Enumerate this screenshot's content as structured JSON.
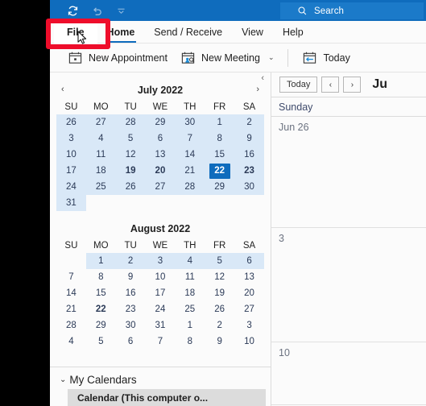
{
  "titlebar": {
    "quick_access": [
      {
        "name": "sync-icon",
        "label": "Send/Receive All Folders"
      },
      {
        "name": "undo-icon",
        "label": "Undo"
      },
      {
        "name": "customize-quick-access-chevron-icon",
        "label": "Customize Quick Access Toolbar"
      }
    ],
    "search": {
      "icon": "search-icon",
      "placeholder": "Search",
      "value": "Search"
    }
  },
  "ribbon": {
    "tabs": [
      {
        "label": "File",
        "active": false,
        "file": true
      },
      {
        "label": "Home",
        "active": true,
        "file": false
      },
      {
        "label": "Send / Receive",
        "active": false,
        "file": false
      },
      {
        "label": "View",
        "active": false,
        "file": false
      },
      {
        "label": "Help",
        "active": false,
        "file": false
      }
    ],
    "commands": [
      {
        "label": "New Appointment",
        "icon": "new-appointment-icon",
        "has_chevron": false
      },
      {
        "label": "New Meeting",
        "icon": "new-meeting-icon",
        "has_chevron": true
      },
      {
        "label": "Today",
        "icon": "today-icon",
        "has_chevron": false
      }
    ],
    "chevron_glyph": "⌄",
    "highlight_color": "#ee0d2b"
  },
  "sidebar": {
    "collapse_chevron": "‹",
    "months": [
      {
        "title": "July 2022",
        "prev_arrow": "‹",
        "next_arrow": "›",
        "weekday_headers": [
          "SU",
          "MO",
          "TU",
          "WE",
          "TH",
          "FR",
          "SA"
        ],
        "weeks": [
          [
            {
              "d": "26",
              "out": true,
              "wk": true,
              "bold": false,
              "today": false
            },
            {
              "d": "27",
              "out": true,
              "wk": true,
              "bold": false,
              "today": false
            },
            {
              "d": "28",
              "out": true,
              "wk": true,
              "bold": false,
              "today": false
            },
            {
              "d": "29",
              "out": true,
              "wk": true,
              "bold": false,
              "today": false
            },
            {
              "d": "30",
              "out": true,
              "wk": true,
              "bold": false,
              "today": false
            },
            {
              "d": "1",
              "out": false,
              "wk": true,
              "bold": false,
              "today": false
            },
            {
              "d": "2",
              "out": false,
              "wk": true,
              "bold": false,
              "today": false
            }
          ],
          [
            {
              "d": "3",
              "out": false,
              "wk": true,
              "bold": false,
              "today": false
            },
            {
              "d": "4",
              "out": false,
              "wk": true,
              "bold": false,
              "today": false
            },
            {
              "d": "5",
              "out": false,
              "wk": true,
              "bold": false,
              "today": false
            },
            {
              "d": "6",
              "out": false,
              "wk": true,
              "bold": false,
              "today": false
            },
            {
              "d": "7",
              "out": false,
              "wk": true,
              "bold": false,
              "today": false
            },
            {
              "d": "8",
              "out": false,
              "wk": true,
              "bold": false,
              "today": false
            },
            {
              "d": "9",
              "out": false,
              "wk": true,
              "bold": false,
              "today": false
            }
          ],
          [
            {
              "d": "10",
              "out": false,
              "wk": true,
              "bold": false,
              "today": false
            },
            {
              "d": "11",
              "out": false,
              "wk": true,
              "bold": false,
              "today": false
            },
            {
              "d": "12",
              "out": false,
              "wk": true,
              "bold": false,
              "today": false
            },
            {
              "d": "13",
              "out": false,
              "wk": true,
              "bold": false,
              "today": false
            },
            {
              "d": "14",
              "out": false,
              "wk": true,
              "bold": false,
              "today": false
            },
            {
              "d": "15",
              "out": false,
              "wk": true,
              "bold": false,
              "today": false
            },
            {
              "d": "16",
              "out": false,
              "wk": true,
              "bold": false,
              "today": false
            }
          ],
          [
            {
              "d": "17",
              "out": false,
              "wk": true,
              "bold": false,
              "today": false
            },
            {
              "d": "18",
              "out": false,
              "wk": true,
              "bold": false,
              "today": false
            },
            {
              "d": "19",
              "out": false,
              "wk": true,
              "bold": true,
              "today": false
            },
            {
              "d": "20",
              "out": false,
              "wk": true,
              "bold": true,
              "today": false
            },
            {
              "d": "21",
              "out": false,
              "wk": true,
              "bold": false,
              "today": false
            },
            {
              "d": "22",
              "out": false,
              "wk": true,
              "bold": true,
              "today": true
            },
            {
              "d": "23",
              "out": false,
              "wk": true,
              "bold": true,
              "today": false
            }
          ],
          [
            {
              "d": "24",
              "out": false,
              "wk": true,
              "bold": false,
              "today": false
            },
            {
              "d": "25",
              "out": false,
              "wk": true,
              "bold": false,
              "today": false
            },
            {
              "d": "26",
              "out": false,
              "wk": true,
              "bold": false,
              "today": false
            },
            {
              "d": "27",
              "out": false,
              "wk": true,
              "bold": false,
              "today": false
            },
            {
              "d": "28",
              "out": false,
              "wk": true,
              "bold": false,
              "today": false
            },
            {
              "d": "29",
              "out": false,
              "wk": true,
              "bold": false,
              "today": false
            },
            {
              "d": "30",
              "out": false,
              "wk": true,
              "bold": false,
              "today": false
            }
          ],
          [
            {
              "d": "31",
              "out": false,
              "wk": true,
              "bold": false,
              "today": false
            },
            {
              "d": "",
              "out": false,
              "wk": false,
              "bold": false,
              "today": false
            },
            {
              "d": "",
              "out": false,
              "wk": false,
              "bold": false,
              "today": false
            },
            {
              "d": "",
              "out": false,
              "wk": false,
              "bold": false,
              "today": false
            },
            {
              "d": "",
              "out": false,
              "wk": false,
              "bold": false,
              "today": false
            },
            {
              "d": "",
              "out": false,
              "wk": false,
              "bold": false,
              "today": false
            },
            {
              "d": "",
              "out": false,
              "wk": false,
              "bold": false,
              "today": false
            }
          ]
        ]
      },
      {
        "title": "August 2022",
        "prev_arrow": "",
        "next_arrow": "",
        "weekday_headers": [
          "SU",
          "MO",
          "TU",
          "WE",
          "TH",
          "FR",
          "SA"
        ],
        "weeks": [
          [
            {
              "d": "",
              "out": false,
              "wk": false,
              "bold": false,
              "today": false
            },
            {
              "d": "1",
              "out": false,
              "wk": true,
              "bold": false,
              "today": false
            },
            {
              "d": "2",
              "out": false,
              "wk": true,
              "bold": false,
              "today": false
            },
            {
              "d": "3",
              "out": false,
              "wk": true,
              "bold": false,
              "today": false
            },
            {
              "d": "4",
              "out": false,
              "wk": true,
              "bold": false,
              "today": false
            },
            {
              "d": "5",
              "out": false,
              "wk": true,
              "bold": false,
              "today": false
            },
            {
              "d": "6",
              "out": false,
              "wk": true,
              "bold": false,
              "today": false
            }
          ],
          [
            {
              "d": "7",
              "out": false,
              "wk": false,
              "bold": false,
              "today": false
            },
            {
              "d": "8",
              "out": false,
              "wk": false,
              "bold": false,
              "today": false
            },
            {
              "d": "9",
              "out": false,
              "wk": false,
              "bold": false,
              "today": false
            },
            {
              "d": "10",
              "out": false,
              "wk": false,
              "bold": false,
              "today": false
            },
            {
              "d": "11",
              "out": false,
              "wk": false,
              "bold": false,
              "today": false
            },
            {
              "d": "12",
              "out": false,
              "wk": false,
              "bold": false,
              "today": false
            },
            {
              "d": "13",
              "out": false,
              "wk": false,
              "bold": false,
              "today": false
            }
          ],
          [
            {
              "d": "14",
              "out": false,
              "wk": false,
              "bold": false,
              "today": false
            },
            {
              "d": "15",
              "out": false,
              "wk": false,
              "bold": false,
              "today": false
            },
            {
              "d": "16",
              "out": false,
              "wk": false,
              "bold": false,
              "today": false
            },
            {
              "d": "17",
              "out": false,
              "wk": false,
              "bold": false,
              "today": false
            },
            {
              "d": "18",
              "out": false,
              "wk": false,
              "bold": false,
              "today": false
            },
            {
              "d": "19",
              "out": false,
              "wk": false,
              "bold": false,
              "today": false
            },
            {
              "d": "20",
              "out": false,
              "wk": false,
              "bold": false,
              "today": false
            }
          ],
          [
            {
              "d": "21",
              "out": false,
              "wk": false,
              "bold": false,
              "today": false
            },
            {
              "d": "22",
              "out": false,
              "wk": false,
              "bold": true,
              "today": false
            },
            {
              "d": "23",
              "out": false,
              "wk": false,
              "bold": false,
              "today": false
            },
            {
              "d": "24",
              "out": false,
              "wk": false,
              "bold": false,
              "today": false
            },
            {
              "d": "25",
              "out": false,
              "wk": false,
              "bold": false,
              "today": false
            },
            {
              "d": "26",
              "out": false,
              "wk": false,
              "bold": false,
              "today": false
            },
            {
              "d": "27",
              "out": false,
              "wk": false,
              "bold": false,
              "today": false
            }
          ],
          [
            {
              "d": "28",
              "out": false,
              "wk": false,
              "bold": false,
              "today": false
            },
            {
              "d": "29",
              "out": false,
              "wk": false,
              "bold": false,
              "today": false
            },
            {
              "d": "30",
              "out": false,
              "wk": false,
              "bold": false,
              "today": false
            },
            {
              "d": "31",
              "out": false,
              "wk": false,
              "bold": false,
              "today": false
            },
            {
              "d": "1",
              "out": true,
              "wk": false,
              "bold": false,
              "today": false
            },
            {
              "d": "2",
              "out": true,
              "wk": false,
              "bold": false,
              "today": false
            },
            {
              "d": "3",
              "out": true,
              "wk": false,
              "bold": false,
              "today": false
            }
          ],
          [
            {
              "d": "4",
              "out": true,
              "wk": false,
              "bold": false,
              "today": false
            },
            {
              "d": "5",
              "out": true,
              "wk": false,
              "bold": false,
              "today": false
            },
            {
              "d": "6",
              "out": true,
              "wk": false,
              "bold": false,
              "today": false
            },
            {
              "d": "7",
              "out": true,
              "wk": false,
              "bold": false,
              "today": false
            },
            {
              "d": "8",
              "out": true,
              "wk": false,
              "bold": false,
              "today": false
            },
            {
              "d": "9",
              "out": true,
              "wk": false,
              "bold": false,
              "today": false
            },
            {
              "d": "10",
              "out": true,
              "wk": false,
              "bold": false,
              "today": false
            }
          ]
        ]
      }
    ],
    "group": {
      "chevron": "⌄",
      "title": "My Calendars",
      "items": [
        {
          "label": "Calendar (This computer o...",
          "selected": true
        }
      ]
    }
  },
  "calendar_view": {
    "toolbar": {
      "today_label": "Today",
      "prev_label": "‹",
      "next_label": "›",
      "range_label": "Ju"
    },
    "columns": [
      {
        "name": "Sunday"
      }
    ],
    "rows": [
      {
        "daynum": "Jun 26"
      },
      {
        "daynum": "3"
      },
      {
        "daynum": "10"
      }
    ]
  },
  "colors": {
    "accent": "#0f6cbd",
    "titlebar": "#0f6cbd",
    "week_highlight": "#d9e8f7",
    "today_bg": "#0f6cbd",
    "highlight_box": "#ee0d2b",
    "selected_item": "#dcdcdc"
  }
}
